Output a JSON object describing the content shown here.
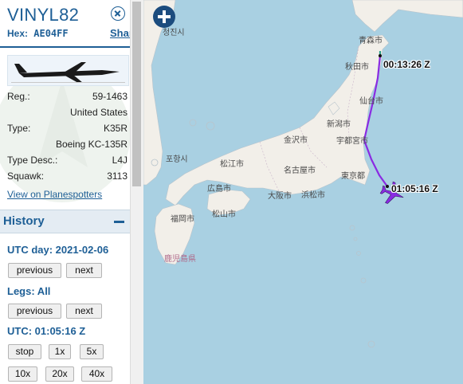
{
  "sidebar": {
    "callsign": "VINYL82",
    "hex_label": "Hex:",
    "hex": "AE04FF",
    "share": "Share",
    "info": {
      "reg_label": "Reg.:",
      "reg_value": "59-1463",
      "country": "United States",
      "type_label": "Type:",
      "type_value": "K35R",
      "type_name": "Boeing KC-135R",
      "type_desc_label": "Type Desc.:",
      "type_desc_value": "L4J",
      "squawk_label": "Squawk:",
      "squawk_value": "3113",
      "planespotters": "View on Planespotters"
    },
    "history": {
      "title": "History",
      "utc_day": "UTC day: 2021-02-06",
      "btn_previous": "previous",
      "btn_next": "next",
      "legs": "Legs: All",
      "utc_time": "UTC: 01:05:16 Z",
      "playback": {
        "stop": "stop",
        "s1": "1x",
        "s5": "5x",
        "s10": "10x",
        "s20": "20x",
        "s40": "40x"
      }
    }
  },
  "map": {
    "timestamp_start": "00:13:26 Z",
    "timestamp_end": "01:05:16 Z",
    "labels": {
      "aomori": "青森市",
      "akita": "秋田市",
      "sendai": "仙台市",
      "niigata": "新潟市",
      "utsunomiya": "宇都宮市",
      "kanazawa": "金沢市",
      "matsue": "松江市",
      "nagoya": "名古屋市",
      "tokyo": "東京都",
      "hiroshima": "広島市",
      "osaka": "大阪市",
      "hamamatsu": "浜松市",
      "fukuoka": "福岡市",
      "matsuyama": "松山市",
      "kagoshima": "鹿児島県",
      "cheongjin": "청진시",
      "pohang": "포항시"
    },
    "colors": {
      "water": "#a9d0e2",
      "land": "#f2efe9",
      "track": "#8a2be2",
      "track_start": "#2fa08a"
    }
  }
}
